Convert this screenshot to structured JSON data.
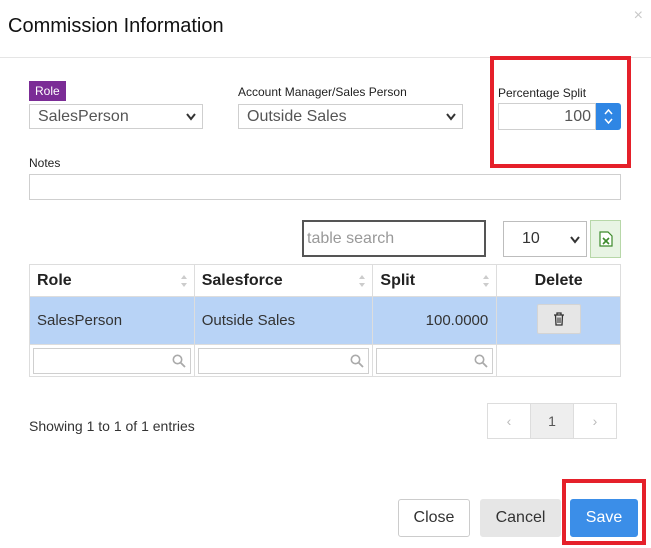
{
  "modal": {
    "title": "Commission Information",
    "close_glyph": "×"
  },
  "form": {
    "role": {
      "badge": "Role",
      "selected": "SalesPerson"
    },
    "account_manager": {
      "label": "Account Manager/Sales Person",
      "selected": "Outside Sales"
    },
    "percentage_split": {
      "label": "Percentage Split",
      "value": "100"
    },
    "notes": {
      "label": "Notes",
      "value": ""
    }
  },
  "table_controls": {
    "search_placeholder": "table search",
    "page_length": "10",
    "excel_icon": "excel-export-icon"
  },
  "table": {
    "columns": [
      "Role",
      "Salesforce",
      "Split",
      "Delete"
    ],
    "rows": [
      {
        "role": "SalesPerson",
        "salesforce": "Outside Sales",
        "split": "100.0000"
      }
    ]
  },
  "footer_info": "Showing 1 to 1 of 1 entries",
  "pagination": {
    "prev": "‹",
    "current": "1",
    "next": "›"
  },
  "buttons": {
    "close": "Close",
    "cancel": "Cancel",
    "save": "Save"
  },
  "colors": {
    "role_badge": "#7b2c96",
    "primary": "#3b8ee8",
    "highlight_frame": "#e5202a",
    "selected_row": "#b8d3f6"
  }
}
